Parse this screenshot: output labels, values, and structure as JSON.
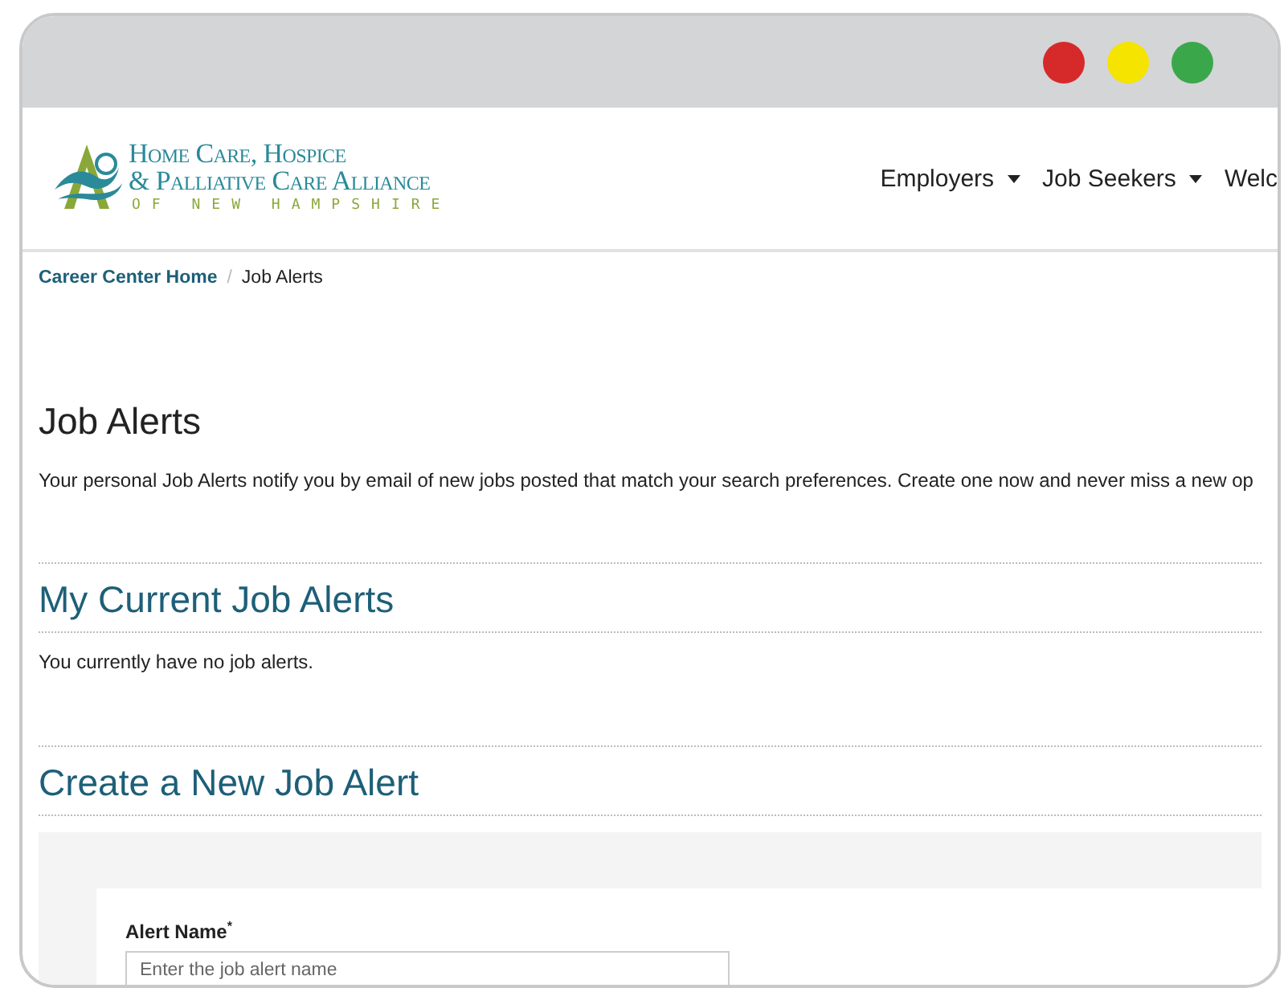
{
  "logo": {
    "line_1": "Home Care, Hospice",
    "line_2": "& Palliative Care Alliance",
    "line_3": "OF NEW HAMPSHIRE"
  },
  "nav": [
    {
      "label": "Employers",
      "dropdown": true
    },
    {
      "label": "Job Seekers",
      "dropdown": true
    },
    {
      "label": "Welc",
      "dropdown": false
    }
  ],
  "breadcrumb_separator": "/",
  "breadcrumb": [
    {
      "label": "Career Center Home",
      "kind": "link"
    },
    {
      "label": "Job Alerts",
      "kind": "current"
    }
  ],
  "title": "Job Alerts",
  "intro": "Your personal Job Alerts notify you by email of new jobs posted that match your search preferences. Create one now and never miss a new op",
  "current_section": {
    "heading": "My Current Job Alerts",
    "empty_text": "You currently have no job alerts."
  },
  "create_section": {
    "heading": "Create a New Job Alert",
    "field": {
      "label": "Alert Name",
      "required": true,
      "required_mark": "*",
      "placeholder": "Enter the job alert name"
    }
  }
}
